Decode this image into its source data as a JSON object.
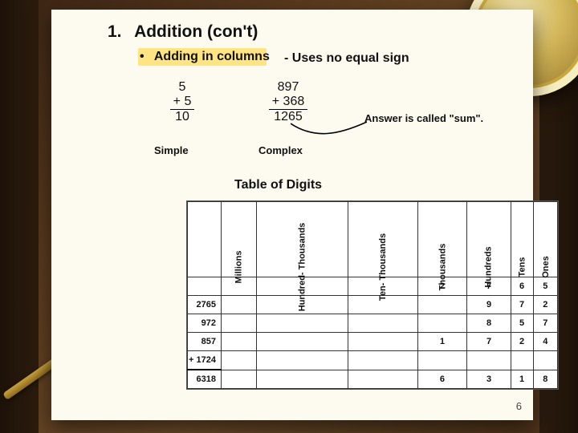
{
  "heading": {
    "number": "1.",
    "text": "Addition (con't)"
  },
  "bullet": {
    "symbol": "•",
    "text": "Adding in columns",
    "aside": "- Uses no equal sign"
  },
  "simple_add": {
    "a": "5",
    "b": "+ 5",
    "sum": "10",
    "label": "Simple"
  },
  "complex_add": {
    "a": "897",
    "b": "+  368",
    "sum": "1265",
    "label": "Complex"
  },
  "callout": "Answer is called \"sum\".",
  "tod_title": "Table of Digits",
  "tod": {
    "headers": [
      "Millions",
      "Hundred-\nThousands",
      "Ten-\nThousands",
      "Thousands",
      "Hundreds",
      "Tens",
      "Ones"
    ],
    "rows": [
      {
        "left": "",
        "cells": [
          "",
          "",
          "",
          "2",
          "7",
          "6",
          "5"
        ]
      },
      {
        "left": "2765",
        "cells": [
          "",
          "",
          "",
          "",
          "9",
          "7",
          "2"
        ]
      },
      {
        "left": "972",
        "cells": [
          "",
          "",
          "",
          "",
          "8",
          "5",
          "7"
        ]
      },
      {
        "left": "857",
        "cells": [
          "",
          "",
          "",
          "1",
          "7",
          "2",
          "4"
        ]
      },
      {
        "left": "+  1724",
        "cells": [
          "",
          "",
          "",
          "",
          "",
          "",
          ""
        ],
        "underline": true
      },
      {
        "left": "6318",
        "cells": [
          "",
          "",
          "",
          "6",
          "3",
          "1",
          "8"
        ],
        "sum": true
      }
    ]
  },
  "page_number": "6"
}
